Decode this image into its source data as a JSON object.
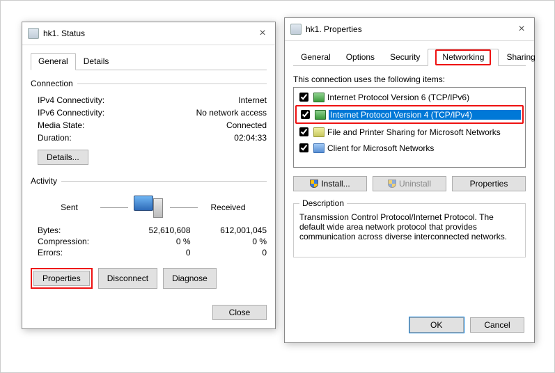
{
  "statusDialog": {
    "title": "hk1. Status",
    "tabs": {
      "general": "General",
      "details": "Details"
    },
    "groupConnection": "Connection",
    "ipv4Label": "IPv4 Connectivity:",
    "ipv4Value": "Internet",
    "ipv6Label": "IPv6 Connectivity:",
    "ipv6Value": "No network access",
    "mediaLabel": "Media State:",
    "mediaValue": "Connected",
    "durationLabel": "Duration:",
    "durationValue": "02:04:33",
    "detailsBtn": "Details...",
    "groupActivity": "Activity",
    "sentLabel": "Sent",
    "receivedLabel": "Received",
    "bytesLabel": "Bytes:",
    "bytesSent": "52,610,608",
    "bytesReceived": "612,001,045",
    "compLabel": "Compression:",
    "compSent": "0 %",
    "compReceived": "0 %",
    "errLabel": "Errors:",
    "errSent": "0",
    "errReceived": "0",
    "propertiesBtn": "Properties",
    "disconnectBtn": "Disconnect",
    "diagnoseBtn": "Diagnose",
    "closeBtn": "Close"
  },
  "propsDialog": {
    "title": "hk1. Properties",
    "tabs": {
      "general": "General",
      "options": "Options",
      "security": "Security",
      "networking": "Networking",
      "sharing": "Sharing"
    },
    "listLabel": "This connection uses the following items:",
    "items": [
      "Internet Protocol Version 6 (TCP/IPv6)",
      "Internet Protocol Version 4 (TCP/IPv4)",
      "File and Printer Sharing for Microsoft Networks",
      "Client for Microsoft Networks"
    ],
    "installBtn": "Install...",
    "uninstallBtn": "Uninstall",
    "propertiesBtn": "Properties",
    "descLegend": "Description",
    "descText": "Transmission Control Protocol/Internet Protocol. The default wide area network protocol that provides communication across diverse interconnected networks.",
    "okBtn": "OK",
    "cancelBtn": "Cancel"
  }
}
